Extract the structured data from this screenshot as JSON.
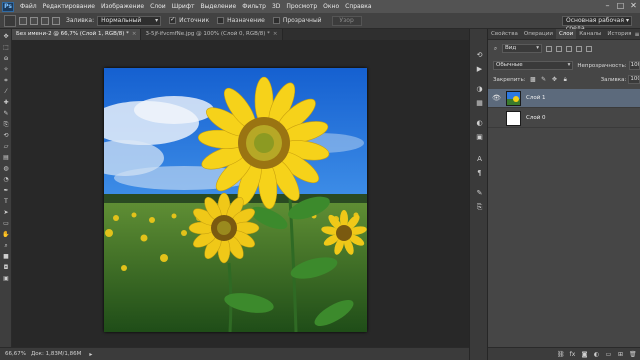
{
  "menubar": {
    "app_logo": "Ps",
    "items": [
      "Файл",
      "Редактирование",
      "Изображение",
      "Слои",
      "Шрифт",
      "Выделение",
      "Фильтр",
      "3D",
      "Просмотр",
      "Окно",
      "Справка"
    ],
    "minimize": "–",
    "maximize": "□",
    "close": "✕"
  },
  "options": {
    "fill_label": "Заливка:",
    "mode_value": "Нормальный",
    "source_label": "Источник",
    "dest_label": "Назначение",
    "transparent_label": "Прозрачный",
    "refine_label": "Узор",
    "workspace_value": "Основная рабочая среда"
  },
  "tabs": [
    {
      "label": "Без имени-2 @ 66,7% (Слой 1, RGB/8) *",
      "close": "×",
      "active": true
    },
    {
      "label": "3-5jf-ifvcmfNe.jpg @ 100% (Слой 0, RGB/8) *",
      "close": "×",
      "active": false
    }
  ],
  "status": {
    "zoom": "66,67%",
    "doc": "Док: 1,83M/1,86M",
    "arrow": "▸"
  },
  "panels": {
    "tabs": [
      "Свойства",
      "Операции",
      "Слои",
      "Каналы",
      "История"
    ],
    "menu_icon": "≡",
    "kind_value": "Вид",
    "blend_value": "Обычные",
    "opacity_label": "Непрозрачность:",
    "opacity_value": "100%",
    "lock_label": "Закрепить:",
    "fill_label": "Заливка:",
    "fill_value": "100%",
    "layers": [
      {
        "name": "Слой 1",
        "active": true
      },
      {
        "name": "Слой 0",
        "active": false
      }
    ]
  },
  "toolbar_icons": [
    "move-icon",
    "marquee-icon",
    "lasso-icon",
    "quick-select-icon",
    "crop-icon",
    "eyedropper-icon",
    "healing-icon",
    "brush-icon",
    "clone-stamp-icon",
    "history-brush-icon",
    "eraser-icon",
    "gradient-icon",
    "blur-icon",
    "dodge-icon",
    "pen-icon",
    "type-icon",
    "path-select-icon",
    "shape-icon",
    "hand-icon",
    "zoom-icon",
    "color-swatch-icon",
    "quick-mask-icon",
    "screen-mode-icon"
  ],
  "colors": {
    "accent_selected_layer": "#5c6a7c",
    "sky": "#1f6fd6",
    "field": "#3a7a2c",
    "petal": "#f4cf18"
  }
}
